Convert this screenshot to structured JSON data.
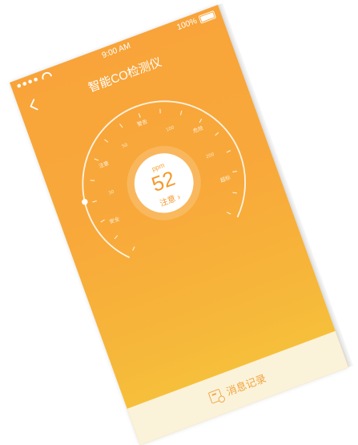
{
  "status_bar": {
    "time": "9:00 AM",
    "battery": "100%"
  },
  "nav": {
    "title": "智能CO检测仪",
    "back_icon": "chevron-left-icon"
  },
  "gauge": {
    "unit": "ppm",
    "value": "52",
    "status": "注意",
    "level": 52,
    "scale_labels": [
      "安全",
      "注意",
      "警告",
      "危险",
      "超标"
    ],
    "scale_numbers": [
      "30",
      "50",
      "100",
      "200"
    ]
  },
  "bottom_bar": {
    "label": "消息记录",
    "icon": "record-icon"
  },
  "colors": {
    "primary": "#f8a43a",
    "accent_bottom": "#f6c63c",
    "bottom_bar_bg": "#fbf2da",
    "text_white": "#ffffff"
  }
}
